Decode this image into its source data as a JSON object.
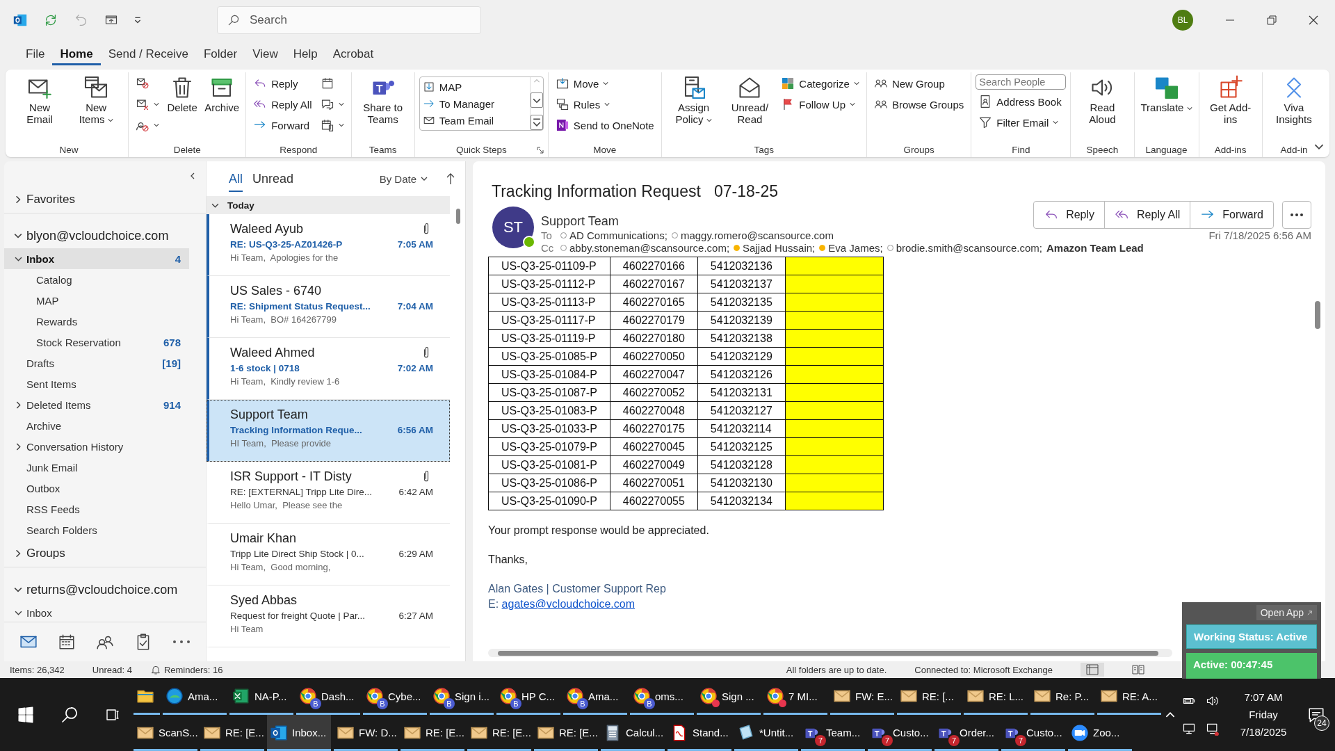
{
  "title_bar": {
    "search": {
      "placeholder": "Search"
    },
    "avatar": "BL"
  },
  "menu_tabs": [
    {
      "label": "File",
      "selected": false
    },
    {
      "label": "Home",
      "selected": true
    },
    {
      "label": "Send / Receive",
      "selected": false
    },
    {
      "label": "Folder",
      "selected": false
    },
    {
      "label": "View",
      "selected": false
    },
    {
      "label": "Help",
      "selected": false
    },
    {
      "label": "Acrobat",
      "selected": false
    }
  ],
  "ribbon": {
    "groups": [
      {
        "label": "New",
        "columns": [
          {
            "kind": "large",
            "items": [
              {
                "label": "New Email"
              },
              {
                "label": "New Items",
                "dropdown": true
              }
            ]
          }
        ]
      },
      {
        "label": "Delete",
        "columns": [
          {
            "kind": "stack",
            "items": [
              {
                "kind": "icon"
              },
              {
                "kind": "icon",
                "dropdown": true
              },
              {
                "kind": "icon",
                "dropdown": true
              }
            ]
          },
          {
            "kind": "large",
            "items": [
              {
                "label": "Delete"
              },
              {
                "label": "Archive"
              }
            ]
          }
        ]
      },
      {
        "label": "Respond",
        "columns": [
          {
            "kind": "stack",
            "items": [
              {
                "label": "Reply"
              },
              {
                "label": "Reply All"
              },
              {
                "label": "Forward"
              }
            ]
          },
          {
            "kind": "stack",
            "items": [
              {
                "kind": "icon"
              },
              {
                "kind": "icon",
                "dropdown": true
              },
              {
                "kind": "icon",
                "dropdown": true
              }
            ]
          }
        ]
      },
      {
        "label": "Teams",
        "columns": [
          {
            "kind": "large",
            "items": [
              {
                "label": "Share to Teams"
              }
            ]
          }
        ]
      },
      {
        "label": "Quick Steps",
        "launcher": true,
        "columns": [
          {
            "kind": "gallery",
            "items": [
              {
                "label": "MAP"
              },
              {
                "label": "To Manager"
              },
              {
                "label": "Team Email"
              }
            ]
          }
        ]
      },
      {
        "label": "Move",
        "columns": [
          {
            "kind": "stack",
            "items": [
              {
                "label": "Move",
                "dropdown": true
              },
              {
                "label": "Rules",
                "dropdown": true
              },
              {
                "label": "Send to OneNote"
              }
            ]
          }
        ]
      },
      {
        "label": "Tags",
        "columns": [
          {
            "kind": "large",
            "items": [
              {
                "label": "Assign Policy",
                "dropdown": true
              },
              {
                "label": "Unread/ Read"
              }
            ]
          },
          {
            "kind": "stack",
            "items": [
              {
                "label": "Categorize",
                "dropdown": true
              },
              {
                "label": "Follow Up",
                "dropdown": true
              }
            ]
          }
        ]
      },
      {
        "label": "Groups",
        "columns": [
          {
            "kind": "stack",
            "items": [
              {
                "label": "New Group"
              },
              {
                "label": "Browse Groups"
              }
            ]
          }
        ]
      },
      {
        "label": "Find",
        "columns": [
          {
            "kind": "stack",
            "items": [
              {
                "kind": "field",
                "placeholder": "Search People"
              },
              {
                "label": "Address Book"
              },
              {
                "label": "Filter Email",
                "dropdown": true
              }
            ]
          }
        ]
      },
      {
        "label": "Speech",
        "columns": [
          {
            "kind": "large",
            "items": [
              {
                "label": "Read Aloud"
              }
            ]
          }
        ]
      },
      {
        "label": "Language",
        "columns": [
          {
            "kind": "large",
            "items": [
              {
                "label": "Translate",
                "dropdown": true
              }
            ]
          }
        ]
      },
      {
        "label": "Add-ins",
        "columns": [
          {
            "kind": "large",
            "items": [
              {
                "label": "Get Add-ins"
              }
            ]
          }
        ]
      },
      {
        "label": "Add-in",
        "columns": [
          {
            "kind": "large",
            "items": [
              {
                "label": "Viva Insights"
              }
            ]
          }
        ]
      }
    ]
  },
  "folder_pane": {
    "sections": [
      {
        "label": "Favorites",
        "kind": "header",
        "expanded": false
      },
      {
        "label": "blyon@vcloudchoice.com",
        "kind": "account",
        "expanded": true,
        "children": [
          {
            "label": "Inbox",
            "selected": true,
            "expanded": true,
            "count": "4",
            "children": [
              {
                "label": "Catalog",
                "selected": false
              },
              {
                "label": "MAP",
                "selected": false
              },
              {
                "label": "Rewards",
                "selected": false
              },
              {
                "label": "Stock Reservation",
                "selected": false,
                "count": "678"
              }
            ]
          },
          {
            "label": "Drafts",
            "selected": false,
            "count": "[19]"
          },
          {
            "label": "Sent Items",
            "selected": false
          },
          {
            "label": "Deleted Items",
            "selected": false,
            "expanded": false,
            "count": "914"
          },
          {
            "label": "Archive",
            "selected": false
          },
          {
            "label": "Conversation History",
            "selected": false,
            "expanded": false
          },
          {
            "label": "Junk Email",
            "selected": false
          },
          {
            "label": "Outbox",
            "selected": false
          },
          {
            "label": "RSS Feeds",
            "selected": false
          },
          {
            "label": "Search Folders",
            "selected": false
          }
        ]
      },
      {
        "label": "Groups",
        "kind": "header",
        "expanded": false
      },
      {
        "label": "returns@vcloudchoice.com",
        "kind": "account",
        "expanded": true,
        "children": [
          {
            "label": "Inbox",
            "selected": false,
            "expanded": true
          }
        ]
      }
    ]
  },
  "message_list": {
    "filters": [
      {
        "label": "All",
        "selected": true
      },
      {
        "label": "Unread",
        "selected": false
      }
    ],
    "sort": "By Date",
    "group": {
      "label": "Today",
      "expanded": true
    },
    "messages": [
      {
        "sender": "Waleed Ayub",
        "subject": "RE: US-Q3-25-AZ01426-P",
        "time": "7:05 AM",
        "preview": "Hi Team,  Apologies for the",
        "unread": true,
        "attachment": true,
        "selected": false
      },
      {
        "sender": "US Sales - 6740",
        "subject": "RE: Shipment Status Request...",
        "time": "7:04 AM",
        "preview": "Hi Team,  BO# 164267799",
        "unread": true,
        "attachment": false,
        "selected": false
      },
      {
        "sender": "Waleed Ahmed",
        "subject": "1-6 stock | 0718",
        "time": "7:02 AM",
        "preview": "Hi Team,  Kindly review 1-6",
        "unread": true,
        "attachment": true,
        "selected": false
      },
      {
        "sender": "Support Team",
        "subject": "Tracking Information Reque...",
        "time": "6:56 AM",
        "preview": "HI Team,  Please provide",
        "unread": true,
        "attachment": false,
        "selected": true
      },
      {
        "sender": "ISR Support - IT Disty",
        "subject": "RE: [EXTERNAL] Tripp Lite Dire...",
        "time": "6:42 AM",
        "preview": "Hello Umar,  Please see the",
        "unread": false,
        "attachment": true,
        "selected": false
      },
      {
        "sender": "Umair Khan",
        "subject": "Tripp Lite Direct Ship Stock | 0...",
        "time": "6:29 AM",
        "preview": "Hi Team,  Good morning,",
        "unread": false,
        "attachment": false,
        "selected": false
      },
      {
        "sender": "Syed Abbas",
        "subject": "Request for freight Quote | Par...",
        "time": "6:27 AM",
        "preview": "Hi Team",
        "unread": false,
        "attachment": false,
        "selected": false
      }
    ]
  },
  "reading_pane": {
    "subject": "Tracking Information Request   07-18-25",
    "avatar": "ST",
    "online": true,
    "sender": "Support Team",
    "date": "Fri 7/18/2025 6:56 AM",
    "to_label": "To",
    "to": [
      {
        "name": "AD Communications;",
        "kind": "person",
        "away": false
      },
      {
        "name": "maggy.romero@scansource.com",
        "kind": "person",
        "away": false
      }
    ],
    "cc_label": "Cc",
    "cc": [
      {
        "name": "abby.stoneman@scansource.com;",
        "kind": "person",
        "away": false
      },
      {
        "name": "Sajjad Hussain;",
        "kind": "person",
        "away": true
      },
      {
        "name": "Eva James;",
        "kind": "person",
        "away": true
      },
      {
        "name": "brodie.smith@scansource.com;",
        "kind": "person",
        "away": false
      },
      {
        "name": "Amazon Team Lead",
        "kind": "group"
      }
    ],
    "actions": [
      {
        "label": "Reply"
      },
      {
        "label": "Reply All"
      },
      {
        "label": "Forward"
      }
    ],
    "table": {
      "rows": [
        [
          "US-Q3-25-01109-P",
          "4602270166",
          "5412032136"
        ],
        [
          "US-Q3-25-01112-P",
          "4602270167",
          "5412032137"
        ],
        [
          "US-Q3-25-01113-P",
          "4602270165",
          "5412032135"
        ],
        [
          "US-Q3-25-01117-P",
          "4602270179",
          "5412032139"
        ],
        [
          "US-Q3-25-01119-P",
          "4602270180",
          "5412032138"
        ],
        [
          "US-Q3-25-01085-P",
          "4602270050",
          "5412032129"
        ],
        [
          "US-Q3-25-01084-P",
          "4602270047",
          "5412032126"
        ],
        [
          "US-Q3-25-01087-P",
          "4602270052",
          "5412032131"
        ],
        [
          "US-Q3-25-01083-P",
          "4602270048",
          "5412032127"
        ],
        [
          "US-Q3-25-01033-P",
          "4602270175",
          "5412032114"
        ],
        [
          "US-Q3-25-01079-P",
          "4602270045",
          "5412032125"
        ],
        [
          "US-Q3-25-01081-P",
          "4602270049",
          "5412032128"
        ],
        [
          "US-Q3-25-01086-P",
          "4602270051",
          "5412032130"
        ],
        [
          "US-Q3-25-01090-P",
          "4602270055",
          "5412032134"
        ]
      ]
    },
    "body": [
      "Your prompt response would be appreciated.",
      "Thanks,"
    ],
    "signature": {
      "line": "Alan Gates | Customer Support Rep",
      "email_label": "E:",
      "email": "agates@vcloudchoice.com"
    }
  },
  "status_bar": {
    "items": "Items: 26,342",
    "unread": "Unread: 4",
    "reminders": "Reminders: 16",
    "sync": "All folders are up to date.",
    "connection": "Connected to: Microsoft Exchange"
  },
  "status_widget": {
    "action": "Open App",
    "status": "Working Status: Active",
    "timer": "Active: 00:47:45"
  },
  "taskbar": {
    "rows": [
      [
        {
          "kind": "folder",
          "selected": false
        },
        {
          "kind": "edge",
          "label": "Ama...",
          "selected": false
        },
        {
          "kind": "excel",
          "label": "NA-P...",
          "selected": false
        },
        {
          "kind": "chrome",
          "badge": "B",
          "label": "Dash...",
          "selected": false
        },
        {
          "kind": "chrome",
          "badge": "B",
          "label": "Cybe...",
          "selected": false
        },
        {
          "kind": "chrome",
          "badge": "B",
          "label": "Sign i...",
          "selected": false
        },
        {
          "kind": "chrome",
          "badge": "B",
          "label": "HP C...",
          "selected": false
        },
        {
          "kind": "chrome",
          "badge": "B",
          "label": "Ama...",
          "selected": false
        },
        {
          "kind": "chrome",
          "badge": "B",
          "label": "oms...",
          "selected": false
        },
        {
          "kind": "chrome-alert",
          "label": "Sign ...",
          "selected": false
        },
        {
          "kind": "chrome-alert",
          "label": "7 MI...",
          "selected": false
        },
        {
          "kind": "mail",
          "label": "FW: E...",
          "selected": false
        },
        {
          "kind": "mail",
          "label": "RE: [...",
          "selected": false
        },
        {
          "kind": "mail",
          "label": "RE: L...",
          "selected": false
        },
        {
          "kind": "mail",
          "label": "Re: P...",
          "selected": false
        },
        {
          "kind": "mail",
          "label": "RE: A...",
          "selected": false
        }
      ],
      [
        {
          "kind": "mail",
          "label": "ScanS...",
          "selected": false
        },
        {
          "kind": "mail",
          "label": "RE: [E...",
          "selected": false
        },
        {
          "kind": "outlook",
          "label": "Inbox...",
          "selected": true
        },
        {
          "kind": "mail",
          "label": "FW: D...",
          "selected": false
        },
        {
          "kind": "mail",
          "label": "RE: [E...",
          "selected": false
        },
        {
          "kind": "mail",
          "label": "RE: [E...",
          "selected": false
        },
        {
          "kind": "mail",
          "label": "RE: [E...",
          "selected": false
        },
        {
          "kind": "calc",
          "label": "Calcul...",
          "selected": false
        },
        {
          "kind": "pdf",
          "label": "Stand...",
          "selected": false
        },
        {
          "kind": "notepad",
          "label": "*Untit...",
          "selected": false
        },
        {
          "kind": "teams",
          "badge": "7",
          "label": "Team...",
          "selected": false
        },
        {
          "kind": "teams",
          "badge": "7",
          "label": "Custo...",
          "selected": false
        },
        {
          "kind": "teams",
          "badge": "7",
          "label": "Order...",
          "selected": false
        },
        {
          "kind": "teams",
          "badge": "7",
          "label": "Custo...",
          "selected": false
        },
        {
          "kind": "zoom",
          "label": "Zoo...",
          "selected": false
        }
      ]
    ],
    "clock": {
      "time": "7:07 AM",
      "day": "Friday",
      "date": "7/18/2025"
    },
    "notifications": "24"
  }
}
